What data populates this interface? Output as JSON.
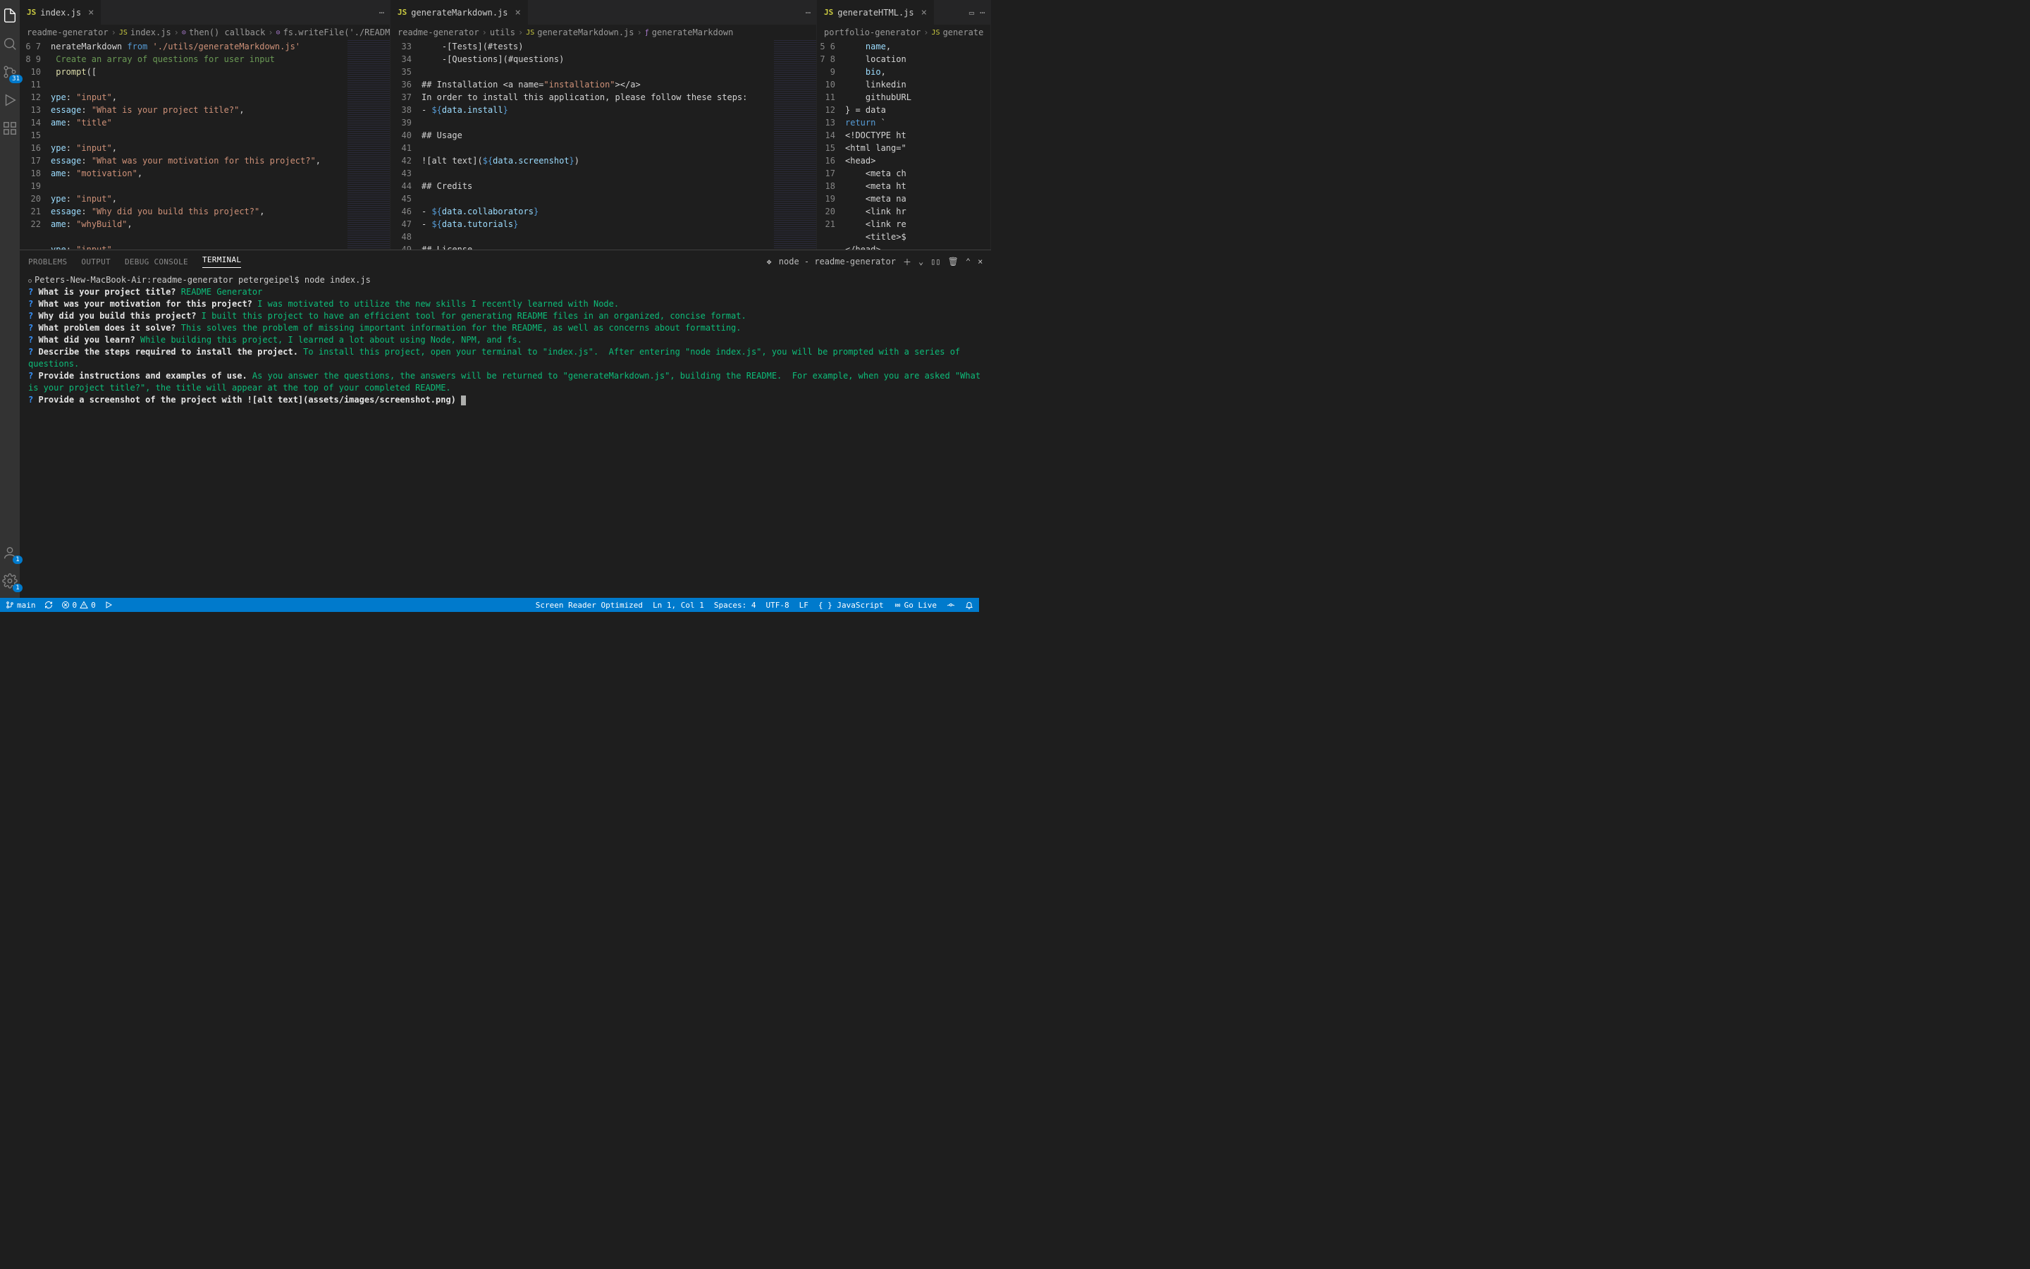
{
  "tabs": {
    "g1": {
      "file": "index.js",
      "icon": "JS"
    },
    "g2": {
      "file": "generateMarkdown.js",
      "icon": "JS"
    },
    "g3": {
      "file": "generateHTML.js",
      "icon": "JS"
    }
  },
  "breadcrumbs": {
    "g1": [
      "readme-generator",
      "index.js",
      "then() callback",
      "fs.writeFile('./README.md') c"
    ],
    "g2": [
      "readme-generator",
      "utils",
      "generateMarkdown.js",
      "generateMarkdown"
    ],
    "g3": [
      "portfolio-generator",
      "generate"
    ]
  },
  "editor1": {
    "start": 6,
    "lines": [
      "nerateMarkdown from './utils/generateMarkdown.js'",
      " Create an array of questions for user input",
      " prompt([",
      "",
      "ype: \"input\",",
      "essage: \"What is your project title?\",",
      "ame: \"title\"",
      "",
      "ype: \"input\",",
      "essage: \"What was your motivation for this project?\",",
      "ame: \"motivation\",",
      "",
      "ype: \"input\",",
      "essage: \"Why did you build this project?\",",
      "ame: \"whyBuild\",",
      "",
      "ype: \"input\","
    ]
  },
  "editor2": {
    "start": 33,
    "lines": [
      "    -[Tests](#tests)",
      "    -[Questions](#questions)",
      "",
      "## Installation <a name=\"installation\"></a>",
      "In order to install this application, please follow these steps:",
      "- ${data.install}",
      "",
      "## Usage",
      "",
      "![alt text](${data.screenshot})",
      "",
      "## Credits",
      "",
      "- ${data.collaborators}",
      "- ${data.tutorials}",
      "",
      "## License",
      ""
    ]
  },
  "editor3": {
    "start": 5,
    "lines": [
      "    name,",
      "    location",
      "    bio,",
      "    linkedin",
      "    githubURL",
      "} = data",
      "return `",
      "<!DOCTYPE ht",
      "<html lang=\"",
      "<head>",
      "    <meta ch",
      "    <meta ht",
      "    <meta na",
      "    <link hr",
      "    <link re",
      "    <title>$",
      "</head>"
    ]
  },
  "panel": {
    "tabs": [
      "PROBLEMS",
      "OUTPUT",
      "DEBUG CONSOLE",
      "TERMINAL"
    ],
    "shell_label": "node - readme-generator"
  },
  "terminal": {
    "prompt": "Peters-New-MacBook-Air:readme-generator petergeipel$ node index.js",
    "qa": [
      {
        "q": "What is your project title?",
        "a": "README Generator"
      },
      {
        "q": "What was your motivation for this project?",
        "a": "I was motivated to utilize the new skills I recently learned with Node."
      },
      {
        "q": "Why did you build this project?",
        "a": "I built this project to have an efficient tool for generating README files in an organized, concise format."
      },
      {
        "q": "What problem does it solve?",
        "a": "This solves the problem of missing important information for the README, as well as concerns about formatting."
      },
      {
        "q": "What did you learn?",
        "a": "While building this project, I learned a lot about using Node, NPM, and fs."
      },
      {
        "q": "Describe the steps required to install the project.",
        "a": "To install this project, open your terminal to \"index.js\".  After entering \"node index.js\", you will be prompted with a series of questions."
      },
      {
        "q": "Provide instructions and examples of use.",
        "a": "As you answer the questions, the answers will be returned to \"generateMarkdown.js\", building the README.  For example, when you are asked \"What is your project title?\", the title will appear at the top of your completed README."
      }
    ],
    "pending": "Provide a screenshot of the project with ![alt text](assets/images/screenshot.png) "
  },
  "status": {
    "branch": "main",
    "errors": "0",
    "warnings": "0",
    "reader": "Screen Reader Optimized",
    "pos": "Ln 1, Col 1",
    "spaces": "Spaces: 4",
    "encoding": "UTF-8",
    "eol": "LF",
    "lang": "JavaScript",
    "live": "Go Live"
  },
  "activity": {
    "sourceBadge": "31",
    "accountBadge": "1",
    "settingsBadge": "1"
  }
}
